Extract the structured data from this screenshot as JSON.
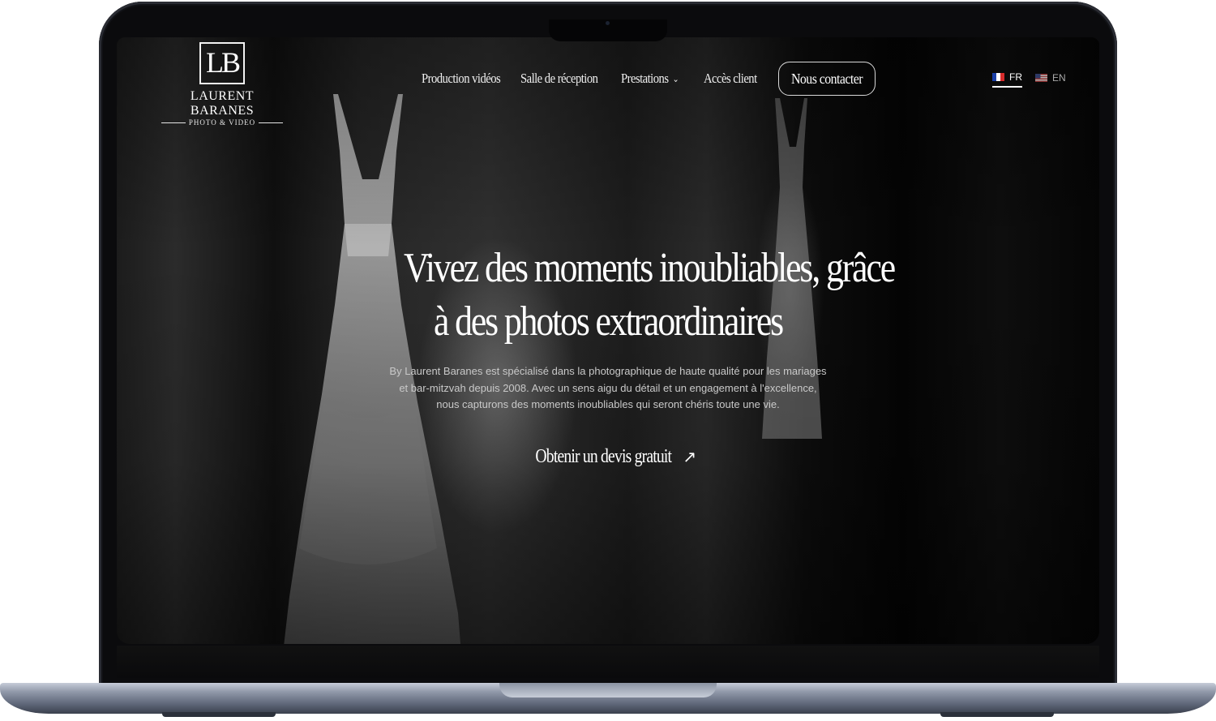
{
  "logo": {
    "monogram": "LB",
    "name": "LAURENT BARANES",
    "tagline": "PHOTO & VIDEO"
  },
  "nav": {
    "items": [
      {
        "label": "Production vidéos"
      },
      {
        "label": "Salle de réception"
      },
      {
        "label": "Prestations",
        "has_dropdown": true
      },
      {
        "label": "Accès client"
      }
    ],
    "contact_label": "Nous contacter",
    "dropdown_icon": "chevron-down-icon"
  },
  "languages": [
    {
      "code": "FR",
      "active": true,
      "flag": "flag-france-icon"
    },
    {
      "code": "EN",
      "active": false,
      "flag": "flag-usa-icon"
    }
  ],
  "hero": {
    "title_line1": "Vivez des moments inoubliables, grâce",
    "title_line2": "à des photos extraordinaires",
    "description_line1": "By Laurent Baranes est spécialisé dans la photographique de haute qualité pour les mariages",
    "description_line2": "et bar-mitzvah depuis 2008. Avec un sens aigu du détail et un engagement à l'excellence,",
    "description_line3": "nous capturons des moments inoubliables qui seront chéris toute une vie.",
    "cta_label": "Obtenir un devis gratuit",
    "cta_icon": "arrow-up-right-icon"
  },
  "colors": {
    "background": "#000000",
    "text": "#ffffff",
    "muted_text": "#c9c9c9",
    "laptop_frame": "#8f97a8"
  }
}
